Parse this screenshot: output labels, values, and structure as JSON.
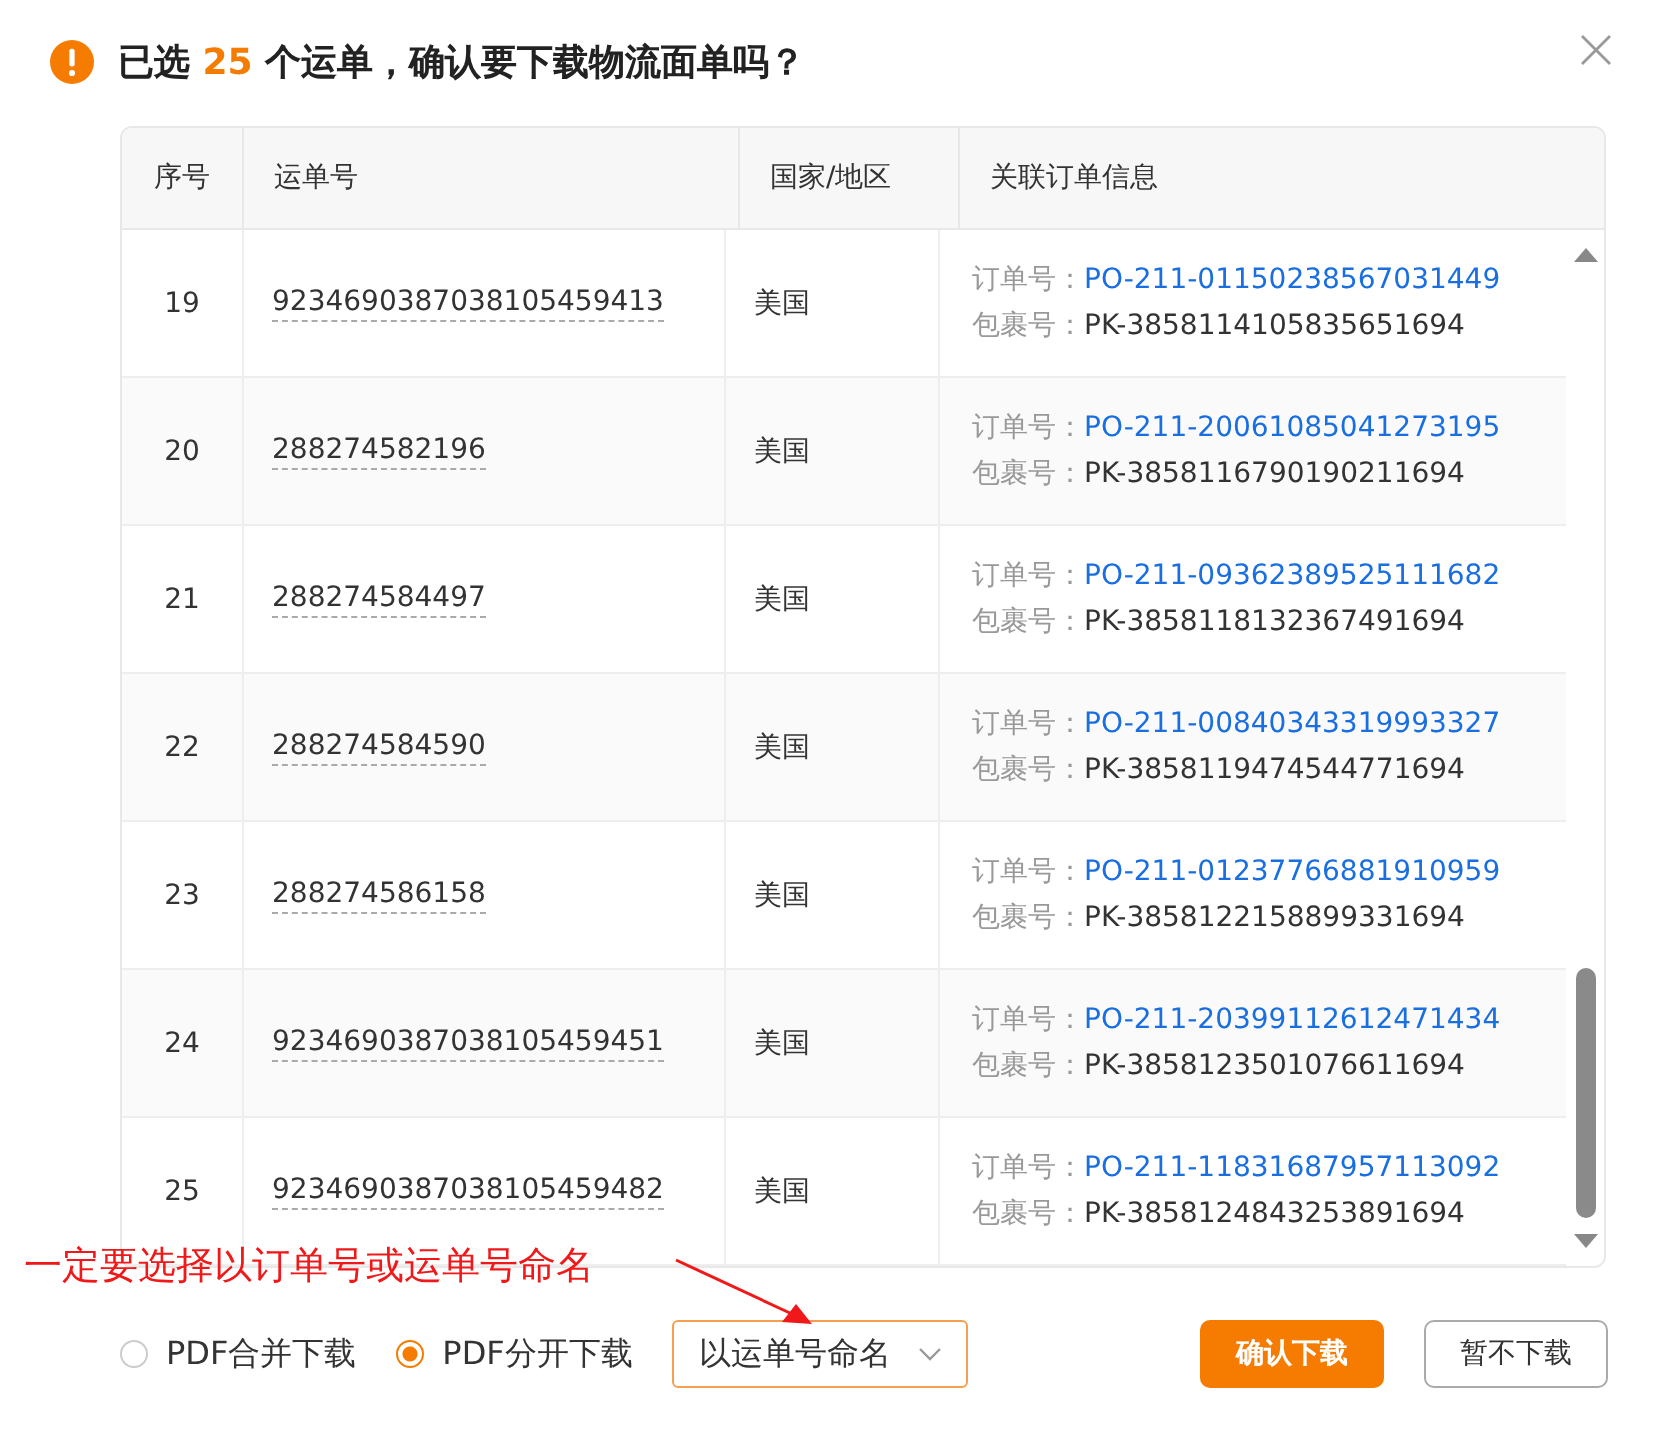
{
  "dialog": {
    "title_prefix": "已选",
    "count": "25",
    "title_suffix": "个运单，确认要下载物流面单吗？"
  },
  "table": {
    "columns": [
      "序号",
      "运单号",
      "国家/地区",
      "关联订单信息"
    ],
    "rows": [
      {
        "index": "19",
        "waybill": "9234690387038105459413",
        "country": "美国",
        "order_label": "订单号：",
        "order_no": "PO-211-01150238567031449",
        "package_label": "包裹号：",
        "package_no": "PK-3858114105835651694"
      },
      {
        "index": "20",
        "waybill": "288274582196",
        "country": "美国",
        "order_label": "订单号：",
        "order_no": "PO-211-20061085041273195",
        "package_label": "包裹号：",
        "package_no": "PK-3858116790190211694"
      },
      {
        "index": "21",
        "waybill": "288274584497",
        "country": "美国",
        "order_label": "订单号：",
        "order_no": "PO-211-09362389525111682",
        "package_label": "包裹号：",
        "package_no": "PK-3858118132367491694"
      },
      {
        "index": "22",
        "waybill": "288274584590",
        "country": "美国",
        "order_label": "订单号：",
        "order_no": "PO-211-00840343319993327",
        "package_label": "包裹号：",
        "package_no": "PK-3858119474544771694"
      },
      {
        "index": "23",
        "waybill": "288274586158",
        "country": "美国",
        "order_label": "订单号：",
        "order_no": "PO-211-01237766881910959",
        "package_label": "包裹号：",
        "package_no": "PK-3858122158899331694"
      },
      {
        "index": "24",
        "waybill": "9234690387038105459451",
        "country": "美国",
        "order_label": "订单号：",
        "order_no": "PO-211-20399112612471434",
        "package_label": "包裹号：",
        "package_no": "PK-3858123501076611694"
      },
      {
        "index": "25",
        "waybill": "9234690387038105459482",
        "country": "美国",
        "order_label": "订单号：",
        "order_no": "PO-211-11831687957113092",
        "package_label": "包裹号：",
        "package_no": "PK-3858124843253891694"
      }
    ]
  },
  "annotation": "一定要选择以订单号或运单号命名",
  "download_modes": [
    {
      "label": "PDF合并下载",
      "selected": false
    },
    {
      "label": "PDF分开下载",
      "selected": true
    }
  ],
  "naming_select": {
    "value": "以运单号命名"
  },
  "buttons": [
    {
      "label": "确认下载",
      "kind": "primary"
    },
    {
      "label": "暂不下载",
      "kind": "default"
    }
  ]
}
